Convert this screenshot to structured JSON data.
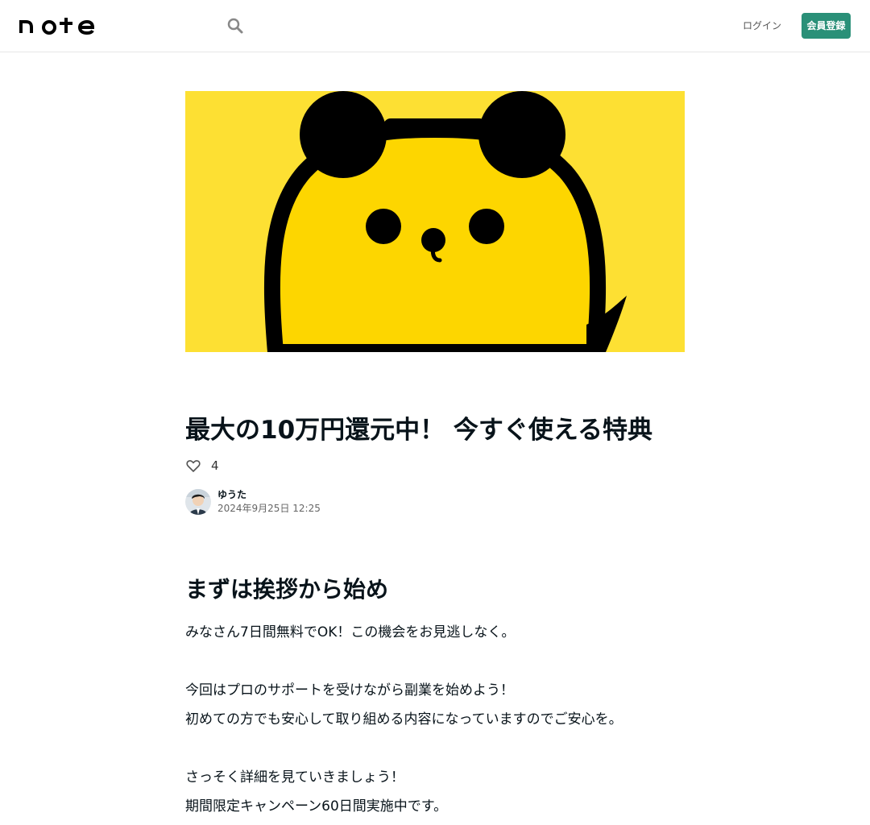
{
  "header": {
    "logo_text": "note",
    "login_label": "ログイン",
    "signup_label": "会員登録"
  },
  "article": {
    "title": "最大の10万円還元中！ 今すぐ使える特典",
    "like_count": "4",
    "author_name": "ゆうた",
    "date": "2024年9月25日 12:25",
    "section_heading": "まずは挨拶から始め",
    "paragraphs": [
      "みなさん7日間無料でOK！この機会をお見逃しなく。",
      "",
      "今回はプロのサポートを受けながら副業を始めよう！",
      "初めての方でも安心して取り組める内容になっていますのでご安心を。",
      "",
      "さっそく詳細を見ていきましょう！",
      "期間限定キャンペーン60日間実施中です。"
    ]
  },
  "colors": {
    "accent": "#2a9078",
    "hero_background": "#fdd600",
    "text": "#08131a"
  },
  "icons": {
    "search": "search-icon",
    "heart": "heart-icon"
  }
}
